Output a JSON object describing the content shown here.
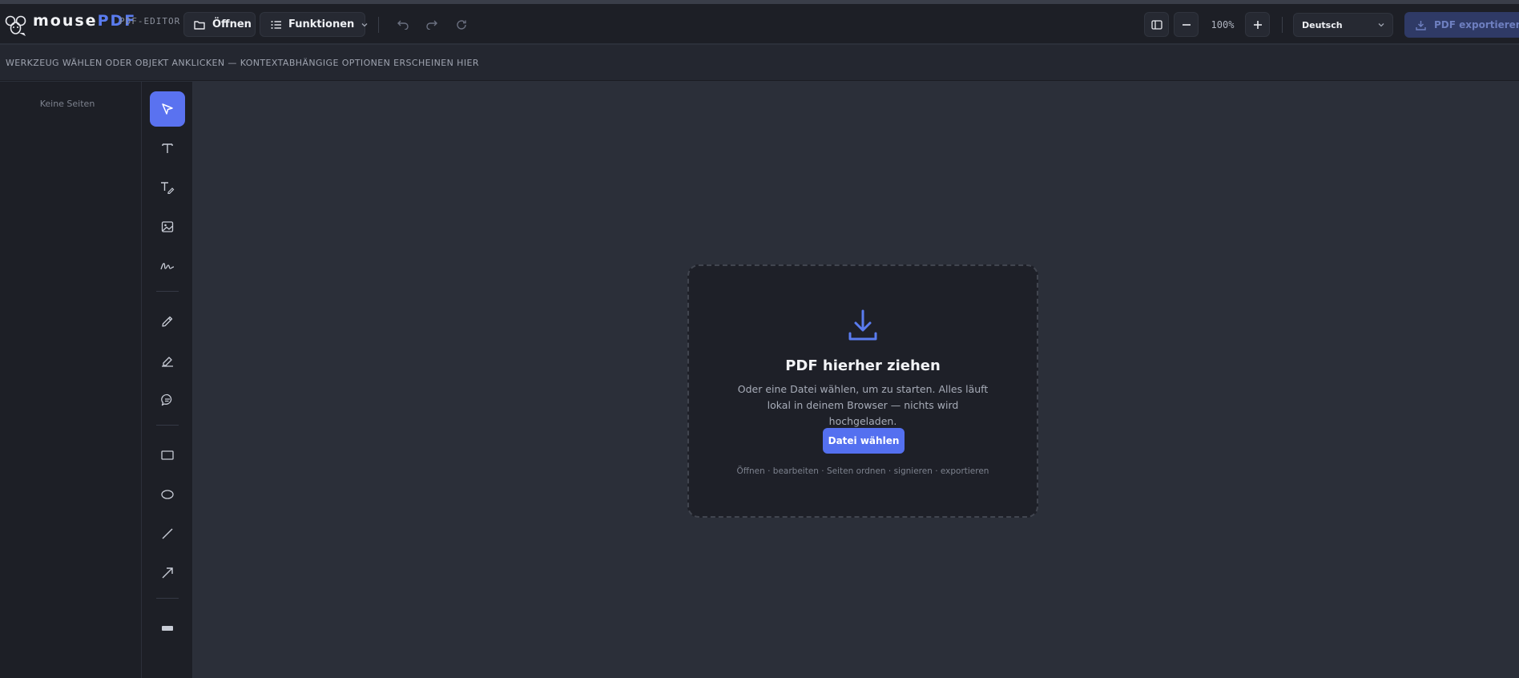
{
  "header": {
    "logo_name_plain": "mouse",
    "logo_name_accent": "PDF",
    "logo_subtitle": "PDF-EDITOR",
    "open_label": "Öffnen",
    "functions_label": "Funktionen",
    "zoom_level": "100%",
    "language_selected": "Deutsch",
    "export_label": "PDF exportieren"
  },
  "hint_bar": {
    "text": "WERKZEUG WÄHLEN ODER OBJEKT ANKLICKEN — KONTEXTABHÄNGIGE OPTIONEN ERSCHEINEN HIER"
  },
  "pages_panel": {
    "empty_text": "Keine Seiten"
  },
  "tools": [
    {
      "name": "select",
      "icon": "cursor-arrow-icon",
      "active": true
    },
    {
      "name": "text",
      "icon": "text-icon"
    },
    {
      "name": "text-edit",
      "icon": "text-pen-icon"
    },
    {
      "name": "image",
      "icon": "image-icon"
    },
    {
      "name": "signature",
      "icon": "signature-icon"
    },
    {
      "name": "pencil",
      "icon": "pencil-icon"
    },
    {
      "name": "highlighter",
      "icon": "highlighter-icon"
    },
    {
      "name": "comment",
      "icon": "comment-icon"
    },
    {
      "name": "rectangle",
      "icon": "rectangle-icon"
    },
    {
      "name": "ellipse",
      "icon": "ellipse-icon"
    },
    {
      "name": "line",
      "icon": "line-icon"
    },
    {
      "name": "arrow",
      "icon": "arrow-icon"
    },
    {
      "name": "redact",
      "icon": "redact-bar-icon"
    }
  ],
  "dropzone": {
    "title": "PDF hierher ziehen",
    "description": "Oder eine Datei wählen, um zu starten. Alles läuft lokal in deinem Browser — nichts wird hochgeladen.",
    "button_label": "Datei wählen",
    "footer": "Öffnen · bearbeiten · Seiten ordnen · signieren · exportieren"
  },
  "colors": {
    "accent": "#5470f0",
    "background": "#2b2f39",
    "panel": "#1d1f26"
  }
}
